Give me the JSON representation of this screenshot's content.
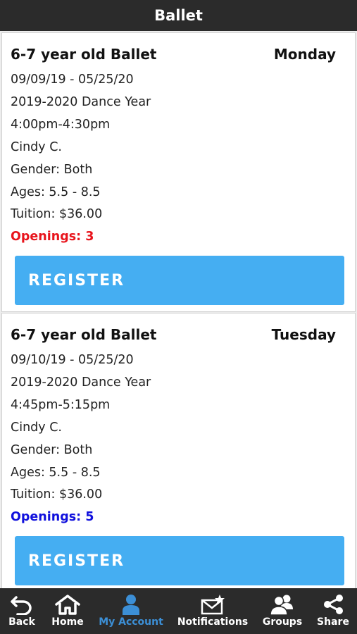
{
  "header": {
    "title": "Ballet"
  },
  "classes": [
    {
      "title": "6-7 year old Ballet",
      "day": "Monday",
      "dates": "09/09/19 - 05/25/20",
      "season": "2019-2020 Dance Year",
      "time": "4:00pm-4:30pm",
      "instructor": "Cindy C.",
      "gender": "Gender: Both",
      "ages": "Ages: 5.5 - 8.5",
      "tuition": "Tuition: $36.00",
      "openings": "Openings: 3",
      "openings_color": "#e8141c",
      "register_label": "REGISTER"
    },
    {
      "title": "6-7 year old Ballet",
      "day": "Tuesday",
      "dates": "09/10/19 - 05/25/20",
      "season": "2019-2020 Dance Year",
      "time": "4:45pm-5:15pm",
      "instructor": "Cindy C.",
      "gender": "Gender: Both",
      "ages": "Ages: 5.5 - 8.5",
      "tuition": "Tuition: $36.00",
      "openings": "Openings: 5",
      "openings_color": "#1010dd",
      "register_label": "REGISTER"
    }
  ],
  "tabbar": {
    "items": [
      {
        "label": "Back",
        "icon": "back-arrow-icon"
      },
      {
        "label": "Home",
        "icon": "home-icon"
      },
      {
        "label": "My Account",
        "icon": "person-icon",
        "active": true
      },
      {
        "label": "Notifications",
        "icon": "envelope-star-icon"
      },
      {
        "label": "Groups",
        "icon": "group-icon"
      },
      {
        "label": "Share",
        "icon": "share-icon"
      }
    ],
    "active_color": "#3c8fd6"
  },
  "colors": {
    "header_bg": "#2b2b2b",
    "register_bg": "#45aef2"
  }
}
